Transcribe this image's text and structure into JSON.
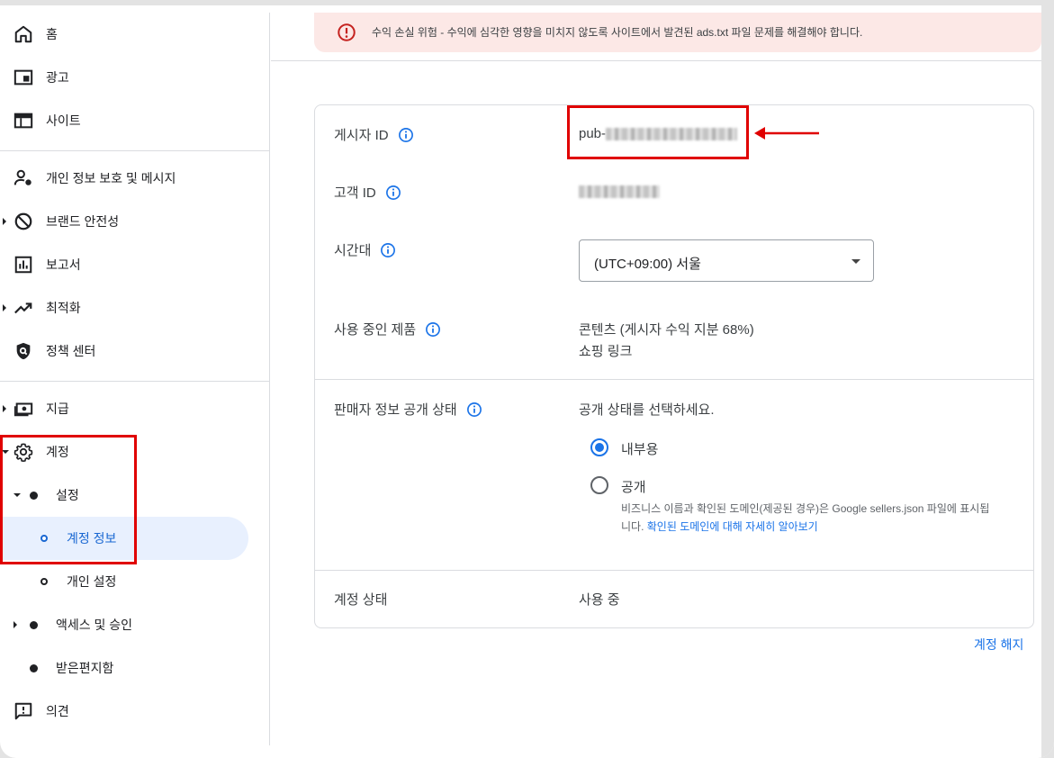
{
  "alert": {
    "text": "수익 손실 위험 - 수익에 심각한 영향을 미치지 않도록 사이트에서 발견된 ads.txt 파일 문제를 해결해야 합니다.",
    "icon": "error-icon"
  },
  "sidebar": {
    "items": [
      {
        "label": "홈",
        "icon": "home-icon"
      },
      {
        "label": "광고",
        "icon": "ads-icon"
      },
      {
        "label": "사이트",
        "icon": "sites-icon"
      },
      {
        "label": "개인 정보 보호 및 메시지",
        "icon": "privacy-icon"
      },
      {
        "label": "브랜드 안전성",
        "icon": "block-icon"
      },
      {
        "label": "보고서",
        "icon": "reports-icon"
      },
      {
        "label": "최적화",
        "icon": "trending-icon"
      },
      {
        "label": "정책 센터",
        "icon": "policy-shield-icon"
      },
      {
        "label": "지급",
        "icon": "payments-icon"
      },
      {
        "label": "계정",
        "icon": "gear-icon"
      },
      {
        "label": "설정"
      },
      {
        "label": "계정 정보"
      },
      {
        "label": "개인 설정"
      },
      {
        "label": "액세스 및 승인"
      },
      {
        "label": "받은편지함"
      },
      {
        "label": "의견",
        "icon": "feedback-icon"
      }
    ]
  },
  "account_info": {
    "publisher_id_label": "게시자 ID",
    "publisher_id_prefix": "pub-",
    "customer_id_label": "고객 ID",
    "timezone_label": "시간대",
    "timezone_value": "(UTC+09:00) 서울",
    "products_label": "사용 중인 제품",
    "products": [
      "콘텐츠 (게시자 수익 지분 68%)",
      "쇼핑 링크"
    ],
    "seller_info_label": "판매자 정보 공개 상태",
    "seller_info_prompt": "공개 상태를 선택하세요.",
    "visibility_options": [
      {
        "label": "내부용",
        "checked": true
      },
      {
        "label": "공개",
        "checked": false
      }
    ],
    "help_text": "비즈니스 이름과 확인된 도메인(제공된 경우)은 Google sellers.json 파일에 표시됩니다. ",
    "help_link": "확인된 도메인에 대해 자세히 알아보기",
    "account_status_label": "계정 상태",
    "account_status_value": "사용 중",
    "close_account": "계정 해지"
  },
  "colors": {
    "accent": "#1a73e8",
    "alert_bg": "#fce8e6",
    "alert_icon": "#c5221f",
    "highlight": "#e00000",
    "active_bg": "#e8f0fe"
  }
}
